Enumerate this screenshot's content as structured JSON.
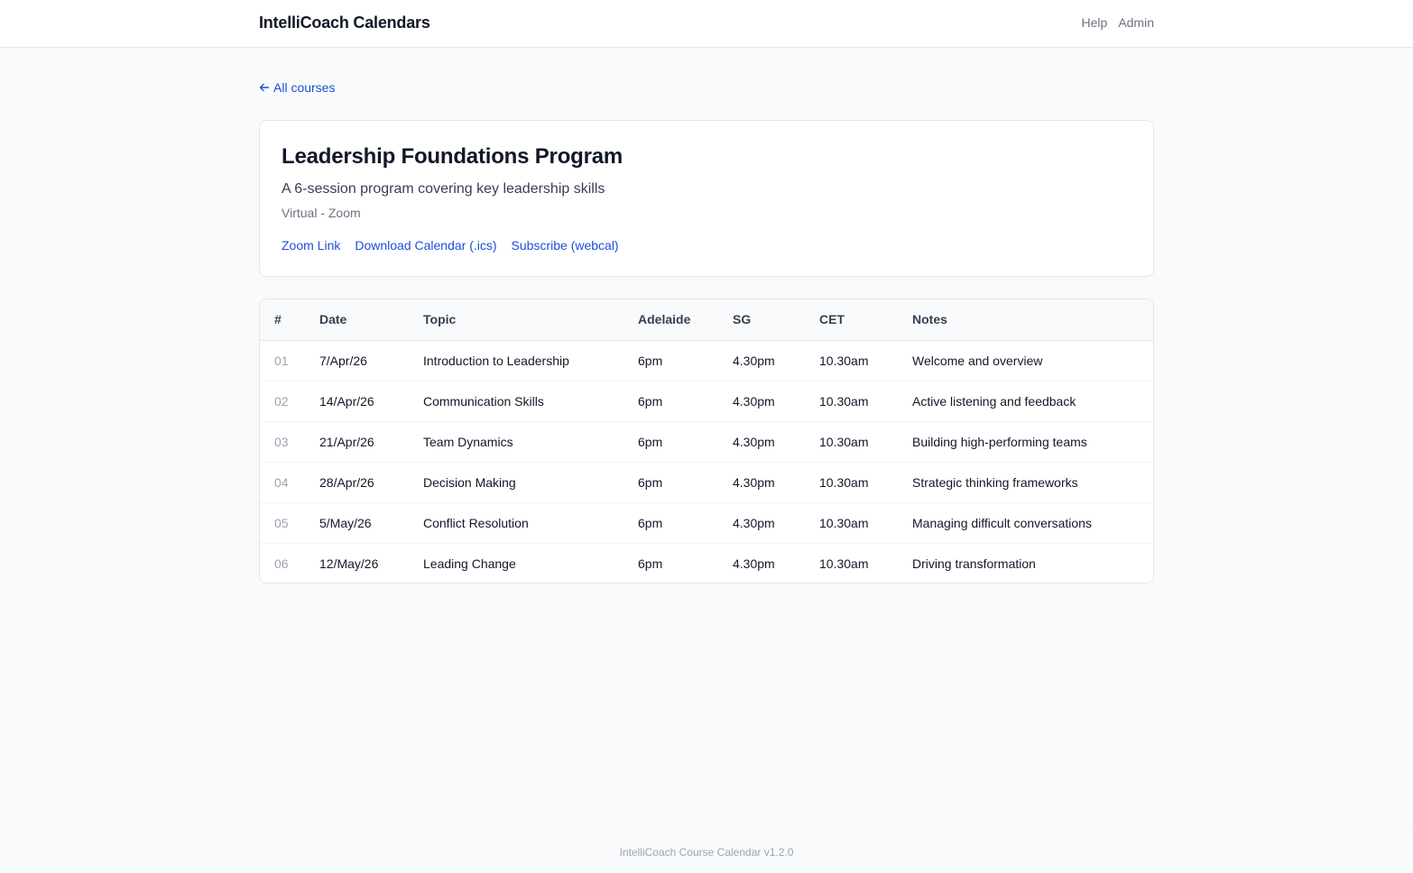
{
  "header": {
    "brand": "IntelliCoach Calendars",
    "nav": [
      "Help",
      "Admin"
    ]
  },
  "back_link": "All courses",
  "course": {
    "title": "Leadership Foundations Program",
    "description": "A 6-session program covering key leadership skills",
    "location": "Virtual - Zoom",
    "links": [
      "Zoom Link",
      "Download Calendar (.ics)",
      "Subscribe (webcal)"
    ]
  },
  "table": {
    "columns": [
      "#",
      "Date",
      "Topic",
      "Adelaide",
      "SG",
      "CET",
      "Notes"
    ],
    "rows": [
      [
        "01",
        "7/Apr/26",
        "Introduction to Leadership",
        "6pm",
        "4.30pm",
        "10.30am",
        "Welcome and overview"
      ],
      [
        "02",
        "14/Apr/26",
        "Communication Skills",
        "6pm",
        "4.30pm",
        "10.30am",
        "Active listening and feedback"
      ],
      [
        "03",
        "21/Apr/26",
        "Team Dynamics",
        "6pm",
        "4.30pm",
        "10.30am",
        "Building high-performing teams"
      ],
      [
        "04",
        "28/Apr/26",
        "Decision Making",
        "6pm",
        "4.30pm",
        "10.30am",
        "Strategic thinking frameworks"
      ],
      [
        "05",
        "5/May/26",
        "Conflict Resolution",
        "6pm",
        "4.30pm",
        "10.30am",
        "Managing difficult conversations"
      ],
      [
        "06",
        "12/May/26",
        "Leading Change",
        "6pm",
        "4.30pm",
        "10.30am",
        "Driving transformation"
      ]
    ]
  },
  "footer": "IntelliCoach Course Calendar v1.2.0",
  "colors": {
    "accent": "#1d4ed8",
    "background": "#f9fafb",
    "text": "#111827"
  }
}
